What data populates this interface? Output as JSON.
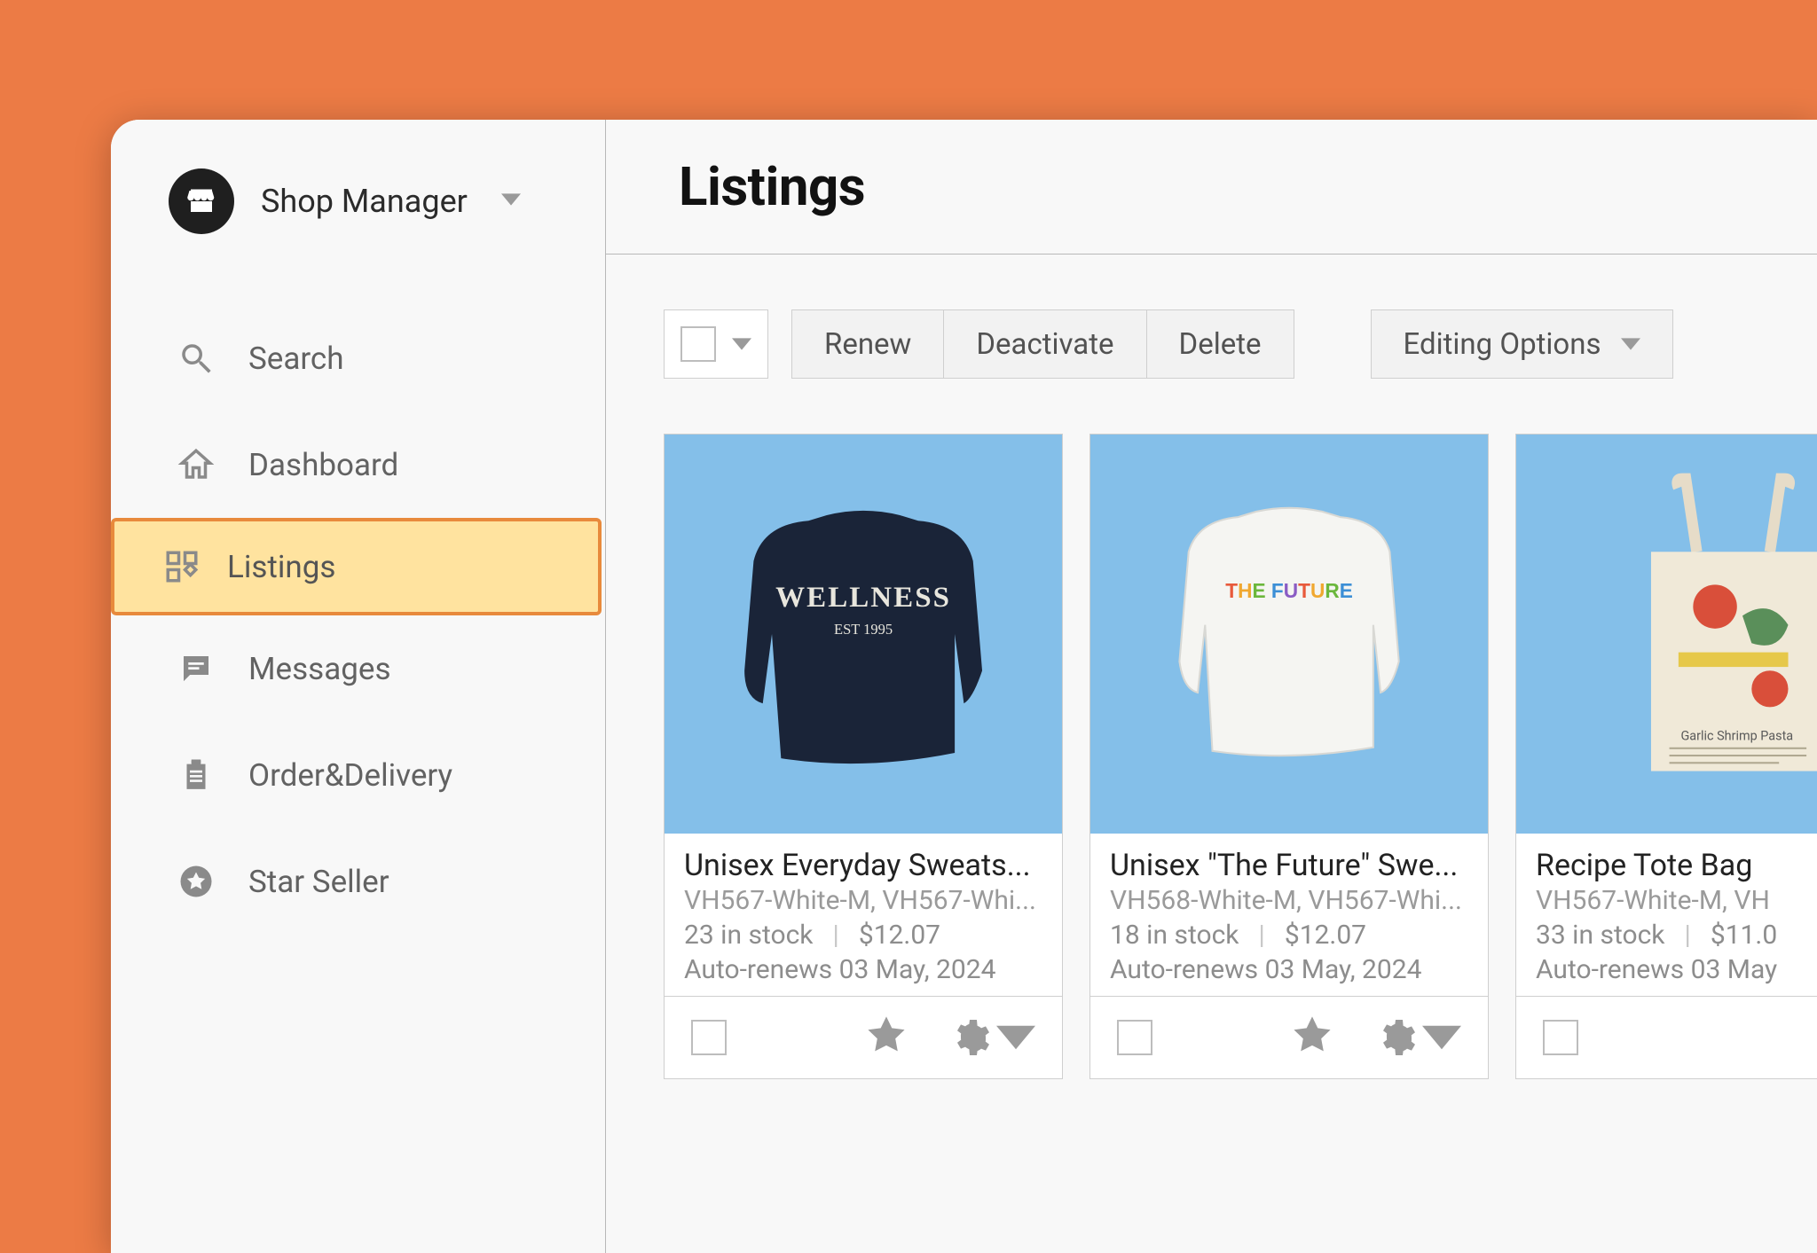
{
  "header": {
    "shop_label": "Shop Manager"
  },
  "nav": {
    "search": "Search",
    "dashboard": "Dashboard",
    "listings": "Listings",
    "messages": "Messages",
    "order_delivery": "Order&Delivery",
    "star_seller": "Star Seller"
  },
  "page": {
    "title": "Listings"
  },
  "toolbar": {
    "renew": "Renew",
    "deactivate": "Deactivate",
    "delete": "Delete",
    "editing_options": "Editing Options"
  },
  "listings": [
    {
      "title": "Unisex Everyday Sweats...",
      "sku": "VH567-White-M, VH567-Whi...",
      "stock": "23 in stock",
      "price": "$12.07",
      "renew": "Auto-renews 03 May, 2024"
    },
    {
      "title": "Unisex \"The Future\" Swe...",
      "sku": "VH568-White-M, VH567-Whi...",
      "stock": "18 in stock",
      "price": "$12.07",
      "renew": "Auto-renews 03 May, 2024"
    },
    {
      "title": "Recipe Tote Bag",
      "sku": "VH567-White-M, VH",
      "stock": "33 in stock",
      "price": "$11.0",
      "renew": "Auto-renews 03 May"
    }
  ]
}
